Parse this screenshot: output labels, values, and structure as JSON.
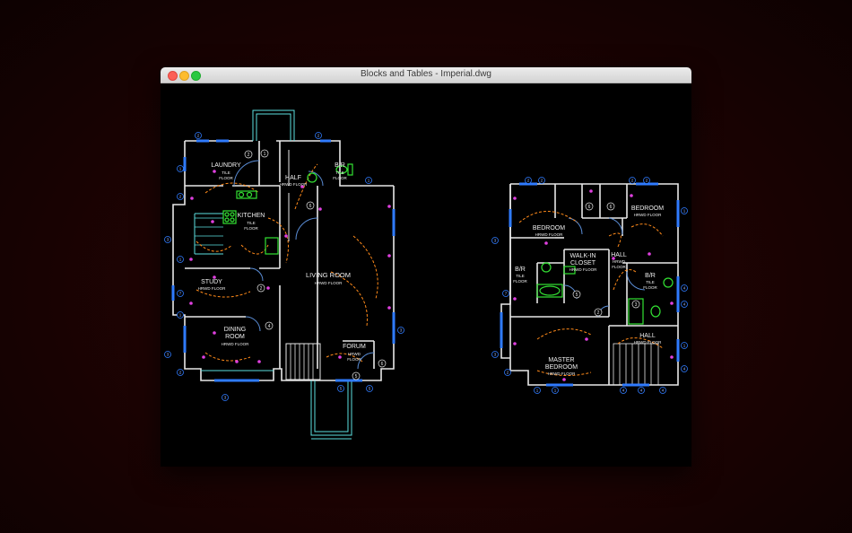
{
  "window": {
    "title": "Blocks and Tables - Imperial.dwg"
  },
  "rooms": {
    "laundry": "LAUNDRY",
    "tile_floor": "TILE",
    "floor": "FLOOR",
    "half": "HALF",
    "hrwd_floor": "HRWD FLOOR",
    "bath": "B/R",
    "kitchen": "KITCHEN",
    "study": "STUDY",
    "dining_1": "DINING",
    "dining_2": "ROOM",
    "living_room": "LIVING ROOM",
    "forum": "FORUM",
    "hrwd": "HRWD",
    "bedroom": "BEDROOM",
    "walkin_1": "WALK-IN",
    "walkin_2": "CLOSET",
    "hall": "HALL",
    "master_1": "MASTER",
    "master_2": "BEDROOM"
  },
  "tags": {
    "one": "1",
    "two": "2",
    "three": "3",
    "four": "4",
    "five": "5",
    "six": "6",
    "seven": "7"
  },
  "colors": {
    "wall": "#e8e8e8",
    "window": "#2f7bff",
    "circuit": "#ff8a1a",
    "fixture": "#33e233",
    "outlet": "#e040e0",
    "porch": "#5ce0e0"
  }
}
